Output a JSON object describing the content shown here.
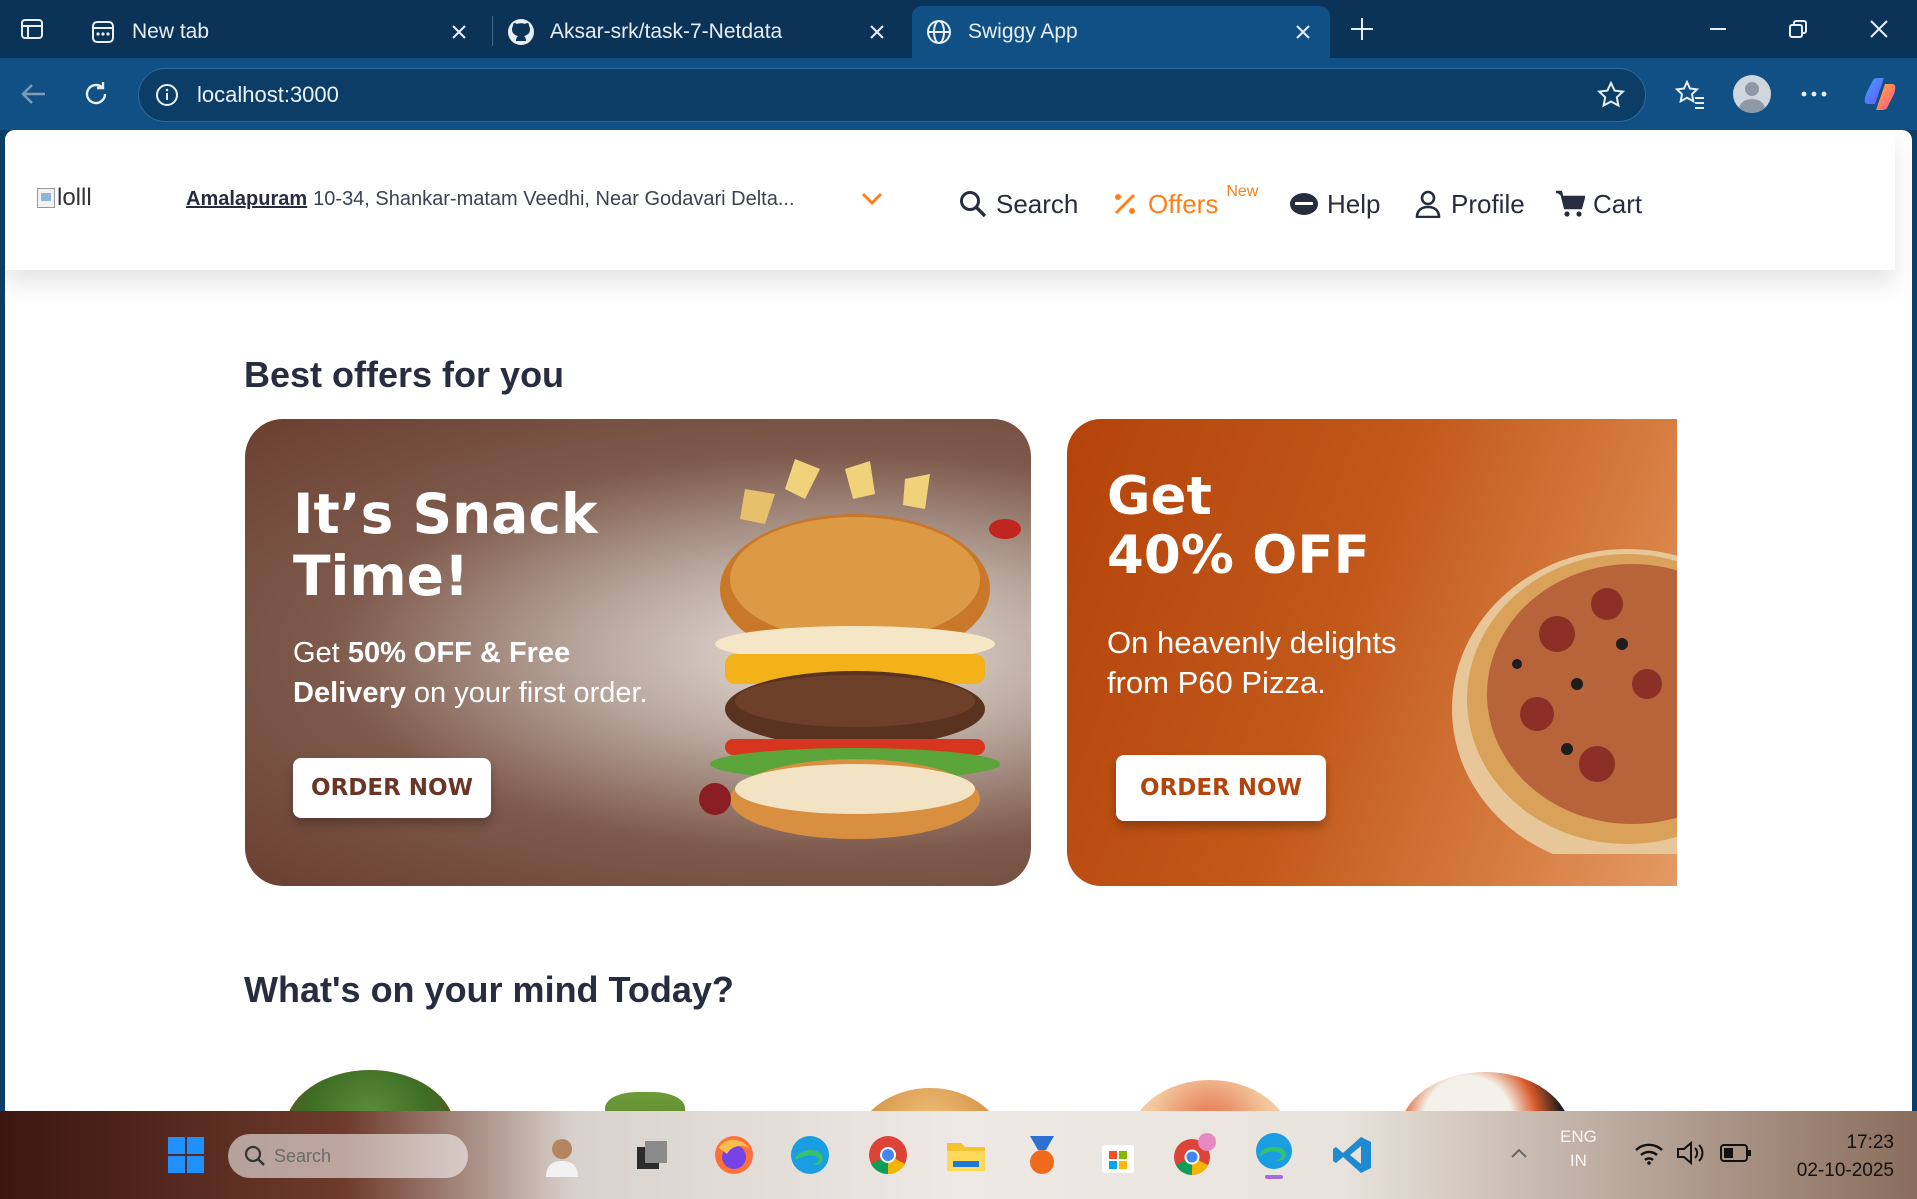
{
  "browser": {
    "tabs": [
      {
        "title": "New tab",
        "icon": "new-tab-page-icon"
      },
      {
        "title": "Aksar-srk/task-7-Netdata",
        "icon": "github-icon"
      },
      {
        "title": "Swiggy App",
        "icon": "globe-icon",
        "active": true
      }
    ],
    "url": "localhost:3000"
  },
  "header": {
    "logo_alt": "lolll",
    "location_city": "Amalapuram",
    "location_address": "10-34, Shankar-matam Veedhi, Near Godavari Delta...",
    "nav": {
      "search": "Search",
      "offers": "Offers",
      "offers_badge": "New",
      "help": "Help",
      "profile": "Profile",
      "cart": "Cart"
    },
    "accent_color": "#fc8019"
  },
  "sections": {
    "offers_title": "Best offers for you",
    "mind_title": "What's on your mind Today?"
  },
  "banners": [
    {
      "headline_line1": "It’s Snack",
      "headline_line2": "Time!",
      "sub_prefix": "Get ",
      "sub_bold": "50% OFF & Free Delivery",
      "sub_suffix": " on your first order.",
      "cta": "ORDER NOW"
    },
    {
      "headline_line1": "Get",
      "headline_line2": "40% OFF",
      "sub_line1": "On heavenly delights",
      "sub_line2": "from P60 Pizza.",
      "cta": "ORDER NOW"
    }
  ],
  "taskbar": {
    "search_placeholder": "Search",
    "lang_line1": "ENG",
    "lang_line2": "IN",
    "time": "17:23",
    "date": "02-10-2025"
  }
}
